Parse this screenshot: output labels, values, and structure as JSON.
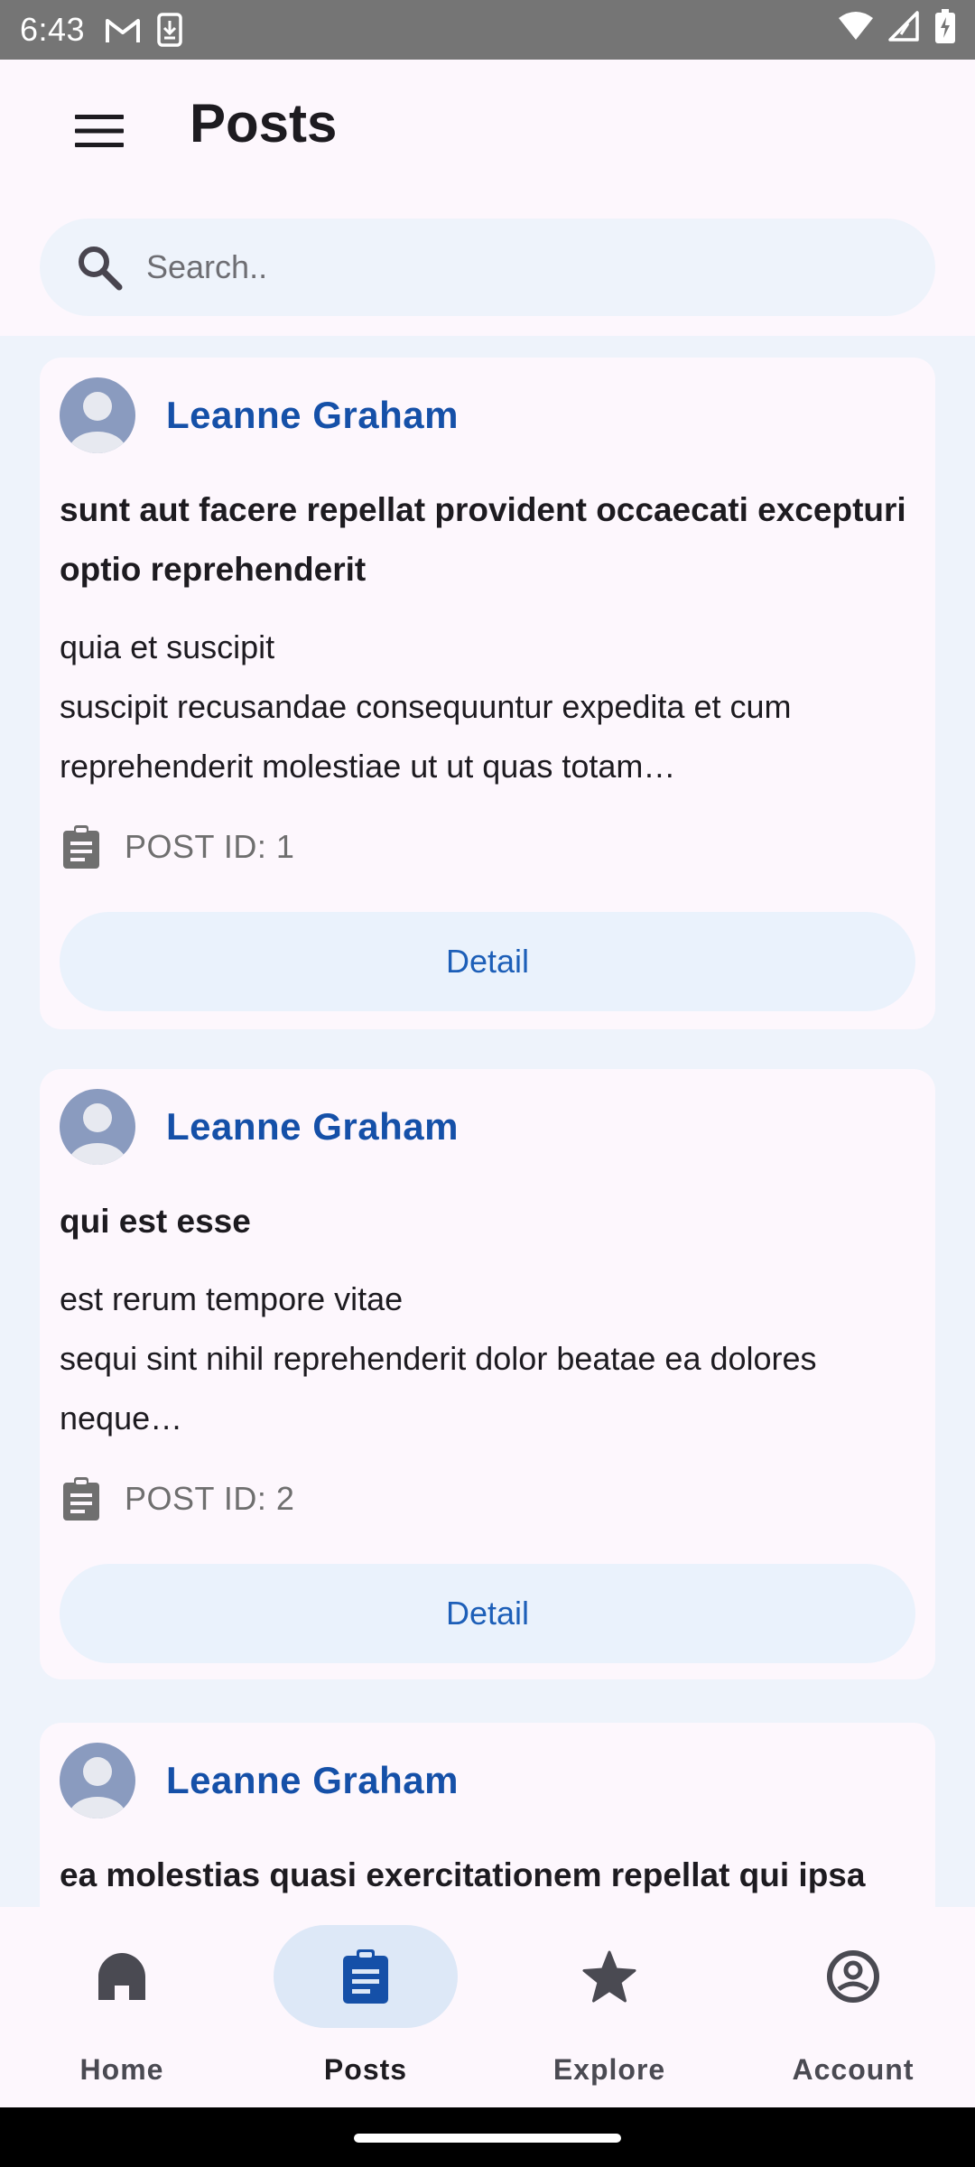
{
  "status_bar": {
    "time": "6:43"
  },
  "app_bar": {
    "title": "Posts"
  },
  "search": {
    "placeholder": "Search..",
    "value": ""
  },
  "posts": [
    {
      "author": "Leanne Graham",
      "title": "sunt aut facere repellat provident occaecati excepturi optio reprehenderit",
      "body": "quia et suscipit\nsuscipit recusandae consequuntur expedita et cum reprehenderit molestiae ut ut quas totam…",
      "post_id_label": "POST ID: 1",
      "button_label": "Detail"
    },
    {
      "author": "Leanne Graham",
      "title": "qui est esse",
      "body": "est rerum tempore vitae\nsequi sint nihil reprehenderit dolor beatae ea dolores neque…",
      "post_id_label": "POST ID: 2",
      "button_label": "Detail"
    },
    {
      "author": "Leanne Graham",
      "title": "ea molestias quasi exercitationem repellat qui ipsa"
    }
  ],
  "bottom_nav": [
    {
      "label": "Home",
      "icon": "home-icon",
      "active": false
    },
    {
      "label": "Posts",
      "icon": "posts-icon",
      "active": true
    },
    {
      "label": "Explore",
      "icon": "star-icon",
      "active": false
    },
    {
      "label": "Account",
      "icon": "account-icon",
      "active": false
    }
  ],
  "colors": {
    "accent": "#1550a8",
    "list_background": "#eef3fb",
    "surface": "#fdf7fd",
    "active_pill": "#dde8f7",
    "status_bar": "#757575"
  }
}
